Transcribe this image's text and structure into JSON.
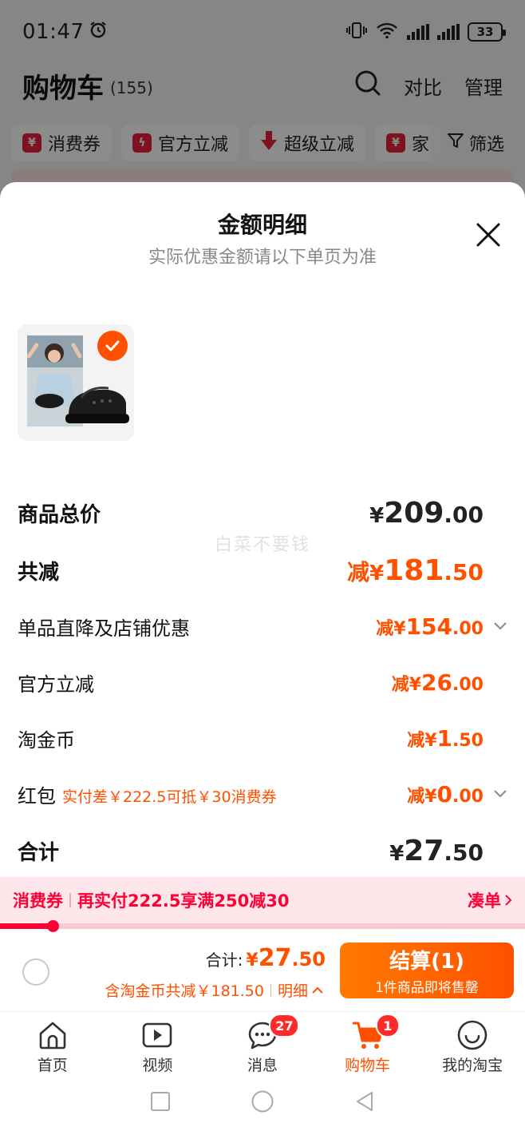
{
  "status_bar": {
    "time": "01:47",
    "battery": "33",
    "alarm_icon": "alarm-icon",
    "vibrate_icon": "vibrate-icon",
    "wifi_icon": "wifi-icon",
    "signal_icon": "signal-icon"
  },
  "cart_header": {
    "title": "购物车",
    "count": "(155)",
    "compare_label": "对比",
    "manage_label": "管理"
  },
  "filter_chips": [
    {
      "icon": "coupon-icon",
      "label": "消费券"
    },
    {
      "icon": "lightning-icon",
      "label": "官方立减"
    },
    {
      "icon": "down-arrow-icon",
      "label": "超级立减"
    },
    {
      "icon": "coupon-icon",
      "label": "家"
    }
  ],
  "filter_label": "筛选",
  "sheet": {
    "title": "金额明细",
    "subtitle": "实际优惠金额请以下单页为准",
    "watermark": "白菜不要钱"
  },
  "price_rows": {
    "goods_total": {
      "label": "商品总价",
      "yen": "¥",
      "int": "209",
      "dec": ".00"
    },
    "total_reduce": {
      "label": "共减",
      "prefix": "减",
      "yen": "¥",
      "int": "181",
      "dec": ".50"
    },
    "shop_discount": {
      "label": "单品直降及店铺优惠",
      "prefix": "减",
      "yen": "¥",
      "int": "154",
      "dec": ".00"
    },
    "official_reduce": {
      "label": "官方立减",
      "prefix": "减",
      "yen": "¥",
      "int": "26",
      "dec": ".00"
    },
    "tao_coin": {
      "label": "淘金币",
      "prefix": "减",
      "yen": "¥",
      "int": "1",
      "dec": ".50"
    },
    "red_packet": {
      "label": "红包",
      "hint": "实付差￥222.5可抵￥30消费券",
      "prefix": "减",
      "yen": "¥",
      "int": "0",
      "dec": ".00"
    },
    "sum": {
      "label": "合计",
      "yen": "¥",
      "int": "27",
      "dec": ".50"
    }
  },
  "coupon_bar": {
    "tag": "消费券",
    "text": "再实付222.5享满250减30",
    "link": "凑单",
    "progress": 0.1
  },
  "checkout": {
    "total_label": "合计:",
    "yen": "¥",
    "int": "27",
    "dec": ".50",
    "discount_text": "含淘金币共减￥181.50",
    "detail_label": "明细",
    "pay_label": "结算(1)",
    "pay_sub": "1件商品即将售罄"
  },
  "tabbar": [
    {
      "icon": "home-icon",
      "label": "首页",
      "badge": ""
    },
    {
      "icon": "video-icon",
      "label": "视频",
      "badge": ""
    },
    {
      "icon": "message-icon",
      "label": "消息",
      "badge": "27"
    },
    {
      "icon": "cart-icon",
      "label": "购物车",
      "badge": "1"
    },
    {
      "icon": "smile-icon",
      "label": "我的淘宝",
      "badge": ""
    }
  ],
  "colors": {
    "accent": "#ff5000",
    "coupon_red": "#ff0036",
    "coupon_bg": "#fde7ea"
  }
}
